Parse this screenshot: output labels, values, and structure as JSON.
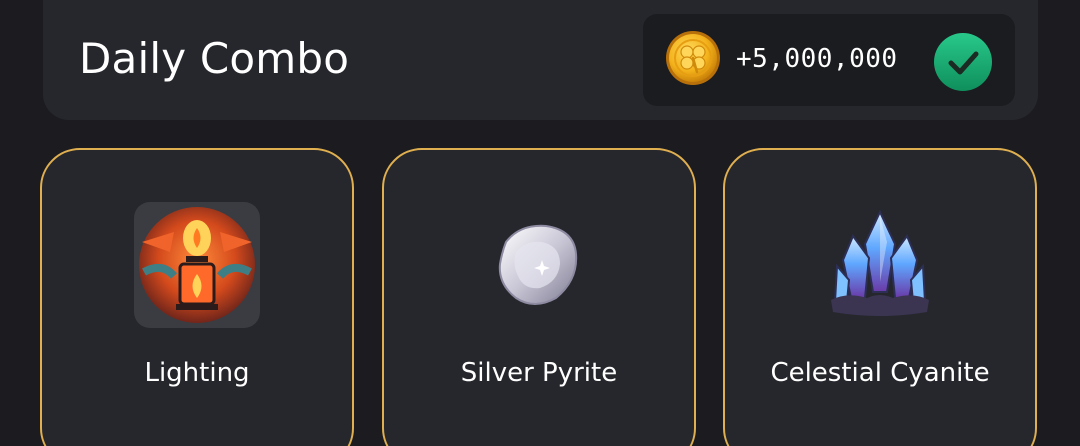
{
  "header": {
    "title": "Daily Combo",
    "reward": "+5,000,000"
  },
  "icons": {
    "coin": "coin-icon",
    "completed": "check-circle-icon"
  },
  "colors": {
    "background": "#1c1c20",
    "panel": "#26272d",
    "card_border": "#e0b050",
    "check_green": "#17a06a",
    "coin_gold": "#f3b21b"
  },
  "cards": [
    {
      "label": "Lighting",
      "icon": "lantern-icon"
    },
    {
      "label": "Silver Pyrite",
      "icon": "silver-gem-icon"
    },
    {
      "label": "Celestial Cyanite",
      "icon": "crystal-cluster-icon"
    }
  ]
}
